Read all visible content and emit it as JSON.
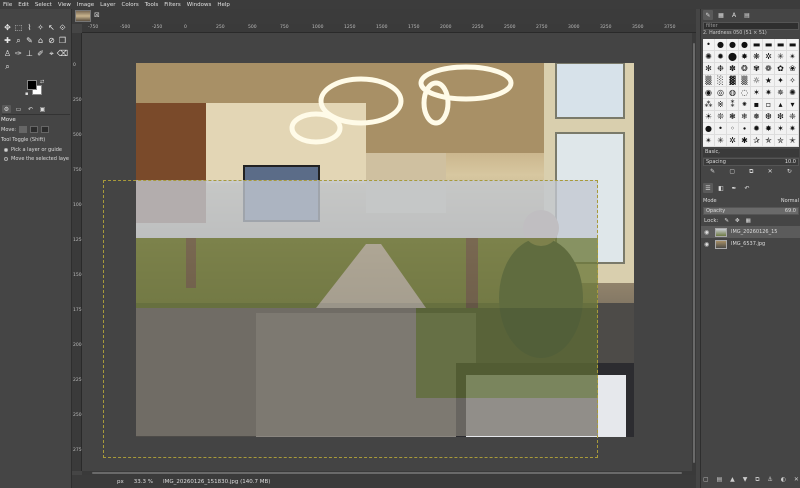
{
  "menubar": [
    "File",
    "Edit",
    "Select",
    "View",
    "Image",
    "Layer",
    "Colors",
    "Tools",
    "Filters",
    "Windows",
    "Help"
  ],
  "toolbox": {
    "tools": [
      "✥",
      "⬚",
      "⌇",
      "✧",
      "↖",
      "⟐",
      "✚",
      "⌕",
      "✎",
      "⌂",
      "⊘",
      "❒",
      "♙",
      "✑",
      "⊥",
      "✐",
      "⌖",
      "⌫",
      "⌕"
    ],
    "tool_options_title": "Move",
    "move_label": "Move:",
    "tool_toggle": "Tool Toggle (Shift)",
    "option_pick": "Pick a layer or guide",
    "option_move_selected": "Move the selected laye"
  },
  "image_tab": {
    "close": "⊠"
  },
  "ruler": {
    "h_ticks": [
      "-750",
      "-500",
      "-250",
      "0",
      "250",
      "500",
      "750",
      "1000",
      "1250",
      "1500",
      "1750",
      "2000",
      "2250",
      "2500",
      "2750",
      "3000",
      "3250",
      "3500",
      "3750"
    ],
    "v_ticks": [
      "0",
      "250",
      "500",
      "750",
      "1000",
      "1250",
      "1500",
      "1750",
      "2000",
      "2250",
      "2500",
      "2750"
    ]
  },
  "statusbar": {
    "unit": "px",
    "zoom": "33.3 %",
    "file_info": "IMG_20260126_151830.jpg (140.7 MB)"
  },
  "brushes": {
    "filter_placeholder": "filter",
    "current": "2. Hardness 050 (51 × 51)",
    "tag": "Basic,",
    "spacing_label": "Spacing",
    "spacing_value": "10.0"
  },
  "layers": {
    "mode_label": "Mode",
    "mode_value": "Normal",
    "opacity_label": "Opacity",
    "opacity_value": "69.0",
    "lock_label": "Lock:",
    "items": [
      {
        "name": "IMG_20260126_15",
        "selected": true
      },
      {
        "name": "IMG_6537.jpg",
        "selected": false
      }
    ]
  }
}
